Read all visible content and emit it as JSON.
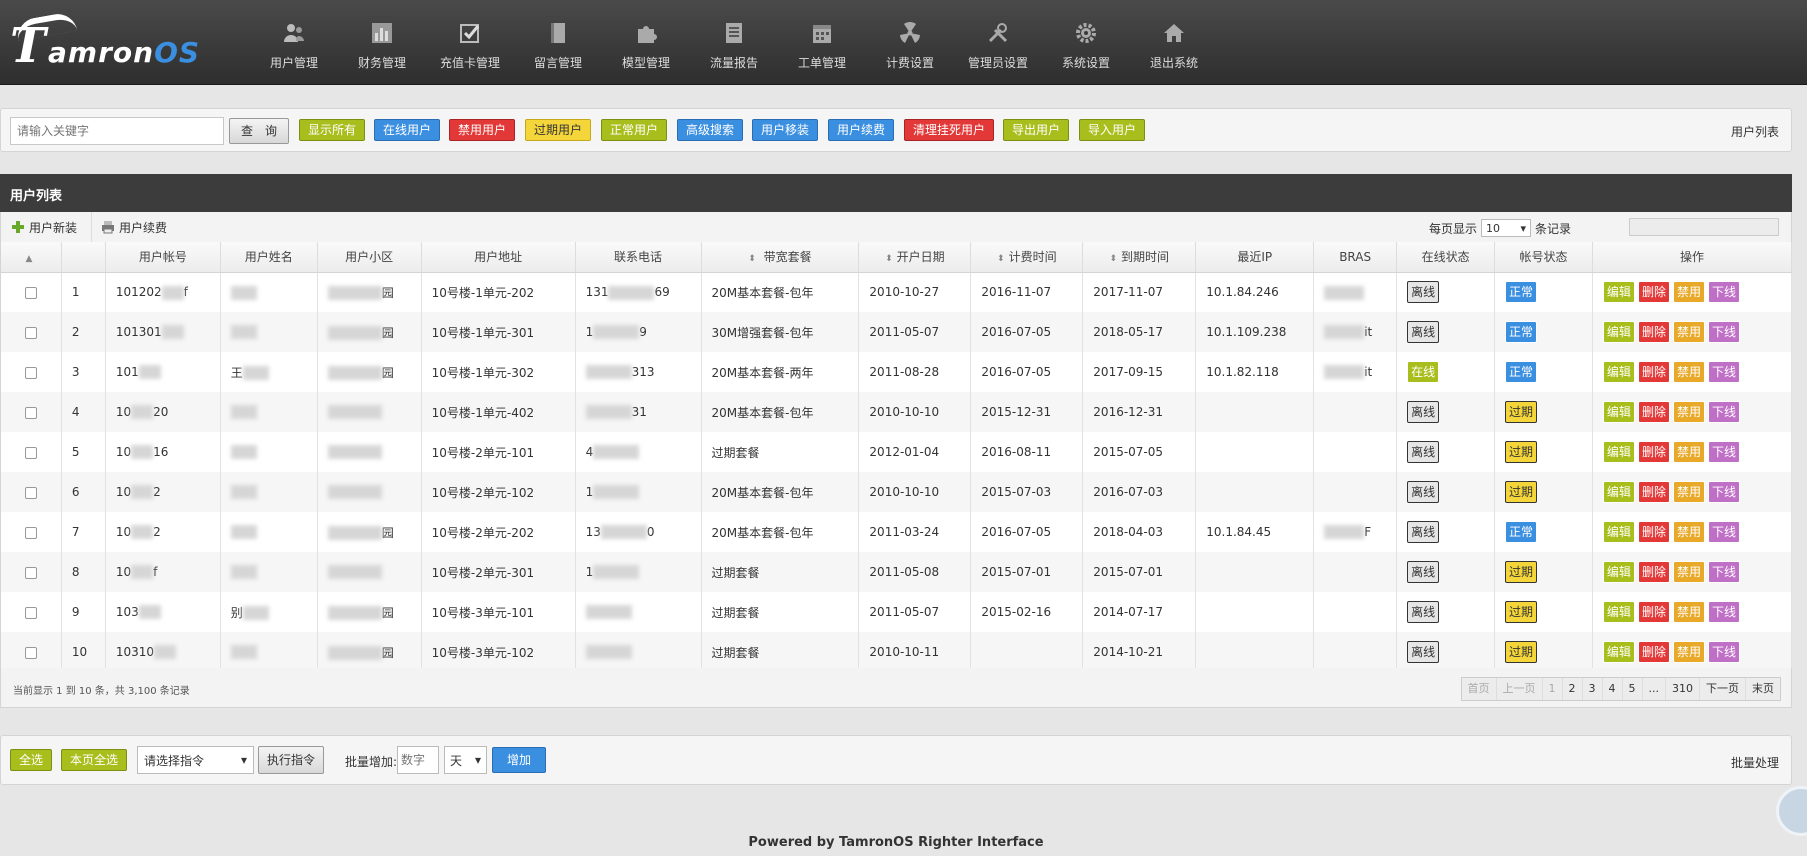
{
  "brand": {
    "logo_t": "T",
    "logo_rest": "amron",
    "logo_os": "OS"
  },
  "nav": [
    {
      "label": "用户管理",
      "icon": "users-icon"
    },
    {
      "label": "财务管理",
      "icon": "bar-chart-icon"
    },
    {
      "label": "充值卡管理",
      "icon": "checkbox-icon"
    },
    {
      "label": "留言管理",
      "icon": "book-icon"
    },
    {
      "label": "模型管理",
      "icon": "puzzle-icon"
    },
    {
      "label": "流量报告",
      "icon": "document-icon"
    },
    {
      "label": "工单管理",
      "icon": "calendar-icon"
    },
    {
      "label": "计费设置",
      "icon": "radiation-icon"
    },
    {
      "label": "管理员设置",
      "icon": "tools-icon"
    },
    {
      "label": "系统设置",
      "icon": "gear-icon"
    },
    {
      "label": "退出系统",
      "icon": "home-icon"
    }
  ],
  "toolbar": {
    "search_placeholder": "请输入关键字",
    "query": "查　询",
    "show_all": "显示所有",
    "online_users": "在线用户",
    "disabled_users": "禁用用户",
    "expired_users": "过期用户",
    "normal_users": "正常用户",
    "advanced_search": "高级搜索",
    "user_transfer": "用户移装",
    "user_renew": "用户续费",
    "clear_dead": "清理挂死用户",
    "export_users": "导出用户",
    "import_users": "导入用户",
    "section_label": "用户列表"
  },
  "panel": {
    "title": "用户列表",
    "new_install": "用户新装",
    "renew": "用户续费",
    "per_page_label": "每页显示",
    "per_page_value": "10",
    "records_label": "条记录"
  },
  "columns": [
    "用户帐号",
    "用户姓名",
    "用户小区",
    "用户地址",
    "联系电话",
    "带宽套餐",
    "开户日期",
    "计费时间",
    "到期时间",
    "最近IP",
    "BRAS",
    "在线状态",
    "帐号状态",
    "操作"
  ],
  "rows": [
    {
      "no": "1",
      "account": "101202",
      "account_tail": "f",
      "name_vis": "",
      "community_tail": "园",
      "address": "10号楼-1单元-202",
      "phone_head": "131",
      "phone_tail": "69",
      "plan": "20M基本套餐-包年",
      "open": "2010-10-27",
      "bill": "2016-11-07",
      "expire": "2017-11-07",
      "ip": "10.1.84.246",
      "bras": "",
      "online": "离线",
      "status": "正常"
    },
    {
      "no": "2",
      "account": "101301",
      "account_tail": "",
      "name_vis": "",
      "community_tail": "园",
      "address": "10号楼-1单元-301",
      "phone_head": "1",
      "phone_tail": "9",
      "plan": "30M增强套餐-包年",
      "open": "2011-05-07",
      "bill": "2016-07-05",
      "expire": "2018-05-17",
      "ip": "10.1.109.238",
      "bras": "it",
      "online": "离线",
      "status": "正常"
    },
    {
      "no": "3",
      "account": "101",
      "account_tail": "",
      "name_vis": "王",
      "community_tail": "园",
      "address": "10号楼-1单元-302",
      "phone_head": "",
      "phone_tail": "313",
      "plan": "20M基本套餐-两年",
      "open": "2011-08-28",
      "bill": "2016-07-05",
      "expire": "2017-09-15",
      "ip": "10.1.82.118",
      "bras": "it",
      "online": "在线",
      "status": "正常"
    },
    {
      "no": "4",
      "account": "10",
      "account_tail": "20",
      "name_vis": "",
      "community_tail": "",
      "address": "10号楼-1单元-402",
      "phone_head": "",
      "phone_tail": "31",
      "plan": "20M基本套餐-包年",
      "open": "2010-10-10",
      "bill": "2015-12-31",
      "expire": "2016-12-31",
      "ip": "",
      "bras": "",
      "online": "离线",
      "status": "过期"
    },
    {
      "no": "5",
      "account": "10",
      "account_tail": "16",
      "name_vis": "",
      "community_tail": "",
      "address": "10号楼-2单元-101",
      "phone_head": "4",
      "phone_tail": "",
      "plan": "过期套餐",
      "open": "2012-01-04",
      "bill": "2016-08-11",
      "expire": "2015-07-05",
      "ip": "",
      "bras": "",
      "online": "离线",
      "status": "过期"
    },
    {
      "no": "6",
      "account": "10",
      "account_tail": "2",
      "name_vis": "",
      "community_tail": "",
      "address": "10号楼-2单元-102",
      "phone_head": "1",
      "phone_tail": "",
      "plan": "20M基本套餐-包年",
      "open": "2010-10-10",
      "bill": "2015-07-03",
      "expire": "2016-07-03",
      "ip": "",
      "bras": "",
      "online": "离线",
      "status": "过期"
    },
    {
      "no": "7",
      "account": "10",
      "account_tail": "2",
      "name_vis": "",
      "community_tail": "园",
      "address": "10号楼-2单元-202",
      "phone_head": "13",
      "phone_tail": "0",
      "plan": "20M基本套餐-包年",
      "open": "2011-03-24",
      "bill": "2016-07-05",
      "expire": "2018-04-03",
      "ip": "10.1.84.45",
      "bras": "F",
      "online": "离线",
      "status": "正常"
    },
    {
      "no": "8",
      "account": "10",
      "account_tail": "f",
      "name_vis": "",
      "community_tail": "",
      "address": "10号楼-2单元-301",
      "phone_head": "1",
      "phone_tail": "",
      "plan": "过期套餐",
      "open": "2011-05-08",
      "bill": "2015-07-01",
      "expire": "2015-07-01",
      "ip": "",
      "bras": "",
      "online": "离线",
      "status": "过期"
    },
    {
      "no": "9",
      "account": "103",
      "account_tail": "",
      "name_vis": "别",
      "community_tail": "园",
      "address": "10号楼-3单元-101",
      "phone_head": "",
      "phone_tail": "",
      "plan": "过期套餐",
      "open": "2011-05-07",
      "bill": "2015-02-16",
      "expire": "2014-07-17",
      "ip": "",
      "bras": "",
      "online": "离线",
      "status": "过期"
    },
    {
      "no": "10",
      "account": "10310",
      "account_tail": "",
      "name_vis": "",
      "community_tail": "园",
      "address": "10号楼-3单元-102",
      "phone_head": "",
      "phone_tail": "",
      "plan": "过期套餐",
      "open": "2010-10-11",
      "bill": "",
      "expire": "2014-10-21",
      "ip": "",
      "bras": "",
      "online": "离线",
      "status": "过期"
    }
  ],
  "actions": {
    "edit": "编辑",
    "delete": "删除",
    "disable": "禁用",
    "kick": "下线"
  },
  "table_footer": {
    "info": "当前显示 1 到 10 条，共 3,100 条记录",
    "pager": [
      "首页",
      "上一页",
      "1",
      "2",
      "3",
      "4",
      "5",
      "...",
      "310",
      "下一页",
      "末页"
    ]
  },
  "batch": {
    "select_all": "全选",
    "page_select_all": "本页全选",
    "cmd_placeholder": "请选择指令",
    "exec": "执行指令",
    "batch_add_label": "批量增加:",
    "num_placeholder": "数字",
    "unit": "天",
    "add": "增加",
    "section_label": "批量处理"
  },
  "footer": "Powered by TamronOS Righter Interface",
  "colors": {
    "green": "#a8be1d",
    "blue": "#3b8fe0",
    "red": "#e33838",
    "yellow": "#f4d63a",
    "purple": "#c06fc7",
    "orange": "#e8a828",
    "header": "#3c3c3c"
  }
}
